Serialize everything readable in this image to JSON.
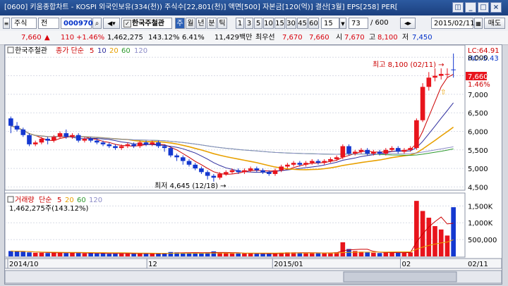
{
  "window": {
    "title": "[0600] 키움종합차트 - KOSPI 외국인보유(334(천)) 주식수[22,801(천)] 액면[500] 자본금[120(억)] 결산[3월] EPS[258] PER[",
    "buttons": [
      "◫",
      "_",
      "□",
      "×"
    ]
  },
  "toolbar": {
    "type_label": "주식",
    "all_label": "전",
    "code_value": "000970",
    "company_name": "한국주철관",
    "periods": [
      "주",
      "월",
      "년",
      "분",
      "틱"
    ],
    "minutes": [
      "1",
      "3",
      "5",
      "10",
      "15",
      "30",
      "45",
      "60"
    ],
    "minute_dropdown": "15",
    "count_value": "73",
    "count_total": "/ 600",
    "date_value": "2015/02/11",
    "trade_button": "매도"
  },
  "quote": {
    "price": "7,660",
    "change": "110",
    "change_pct": "+1.46%",
    "volume": "1,462,275",
    "vol_ratio": "143.12%",
    "turnover": "6.41%",
    "amount": "11,429백만",
    "pref_label": "최우선",
    "pref_ask": "7,670",
    "pref_bid": "7,660",
    "open_label": "시",
    "open": "7,670",
    "high_label": "고",
    "high": "8,100",
    "low_label": "저",
    "low": "7,450"
  },
  "price_panel": {
    "company": "한국주철관",
    "legend_label": "종가 단순",
    "ma_periods": [
      "5",
      "10",
      "20",
      "60",
      "120"
    ],
    "ma_colors": [
      "#cc0000",
      "#2f2f9f",
      "#e8a000",
      "#2e9a2e",
      "#8c8cc8"
    ],
    "lc_label": "LC:64.91",
    "hc_label": "HC:-5.43",
    "high_annotation": "최고 8,100 (02/11) →",
    "low_annotation": "최저 4,645 (12/18) →",
    "price_tag": "7,660",
    "pct_tag": "1.46%",
    "y_ticks": [
      "8,000",
      "7,500",
      "7,000",
      "6,500",
      "6,000",
      "5,500",
      "5,000",
      "4,500"
    ]
  },
  "volume_panel": {
    "title": "거래량",
    "legend_label": "단순",
    "ma_periods": [
      "5",
      "20",
      "60",
      "120"
    ],
    "readout": "1,462,275주(143.12%)",
    "y_ticks": [
      "1,500K",
      "1,000K",
      "500,000"
    ]
  },
  "x_axis": {
    "labels": [
      "2014/10",
      "12",
      "2015/01",
      "02",
      "02/11"
    ]
  },
  "colors": {
    "up": "#e8141c",
    "down": "#1438d0",
    "title_bar": "#1b3f7e"
  },
  "chart_data": {
    "type": "candlestick",
    "date_range": [
      "2014/10",
      "2015/02/11"
    ],
    "price_range": [
      4500,
      8100
    ],
    "high": {
      "value": 8100,
      "date": "02/11"
    },
    "low": {
      "value": 4645,
      "date": "12/18"
    },
    "candles": [
      [
        6350,
        6150,
        6400,
        5950
      ],
      [
        6150,
        6050,
        6250,
        6000
      ],
      [
        6050,
        5900,
        6100,
        5850
      ],
      [
        5900,
        5650,
        5950,
        5600
      ],
      [
        5650,
        5700,
        5750,
        5600
      ],
      [
        5700,
        5800,
        5850,
        5650
      ],
      [
        5800,
        5750,
        5850,
        5650
      ],
      [
        5750,
        5850,
        5900,
        5700
      ],
      [
        5850,
        5950,
        6000,
        5800
      ],
      [
        5950,
        5850,
        6050,
        5800
      ],
      [
        5850,
        5900,
        5950,
        5800
      ],
      [
        5900,
        5750,
        5950,
        5700
      ],
      [
        5750,
        5800,
        5850,
        5700
      ],
      [
        5800,
        5750,
        5850,
        5700
      ],
      [
        5750,
        5700,
        5800,
        5650
      ],
      [
        5700,
        5650,
        5750,
        5600
      ],
      [
        5650,
        5600,
        5700,
        5550
      ],
      [
        5600,
        5550,
        5650,
        5500
      ],
      [
        5550,
        5600,
        5650,
        5500
      ],
      [
        5600,
        5650,
        5700,
        5550
      ],
      [
        5650,
        5600,
        5700,
        5550
      ],
      [
        5600,
        5700,
        5750,
        5550
      ],
      [
        5700,
        5650,
        5750,
        5600
      ],
      [
        5650,
        5700,
        5750,
        5600
      ],
      [
        5700,
        5600,
        5750,
        5550
      ],
      [
        5600,
        5550,
        5650,
        5450
      ],
      [
        5550,
        5350,
        5600,
        5300
      ],
      [
        5350,
        5300,
        5400,
        5200
      ],
      [
        5300,
        5200,
        5350,
        5100
      ],
      [
        5200,
        5100,
        5250,
        5050
      ],
      [
        5100,
        5000,
        5150,
        4950
      ],
      [
        5000,
        4900,
        5050,
        4850
      ],
      [
        4900,
        4800,
        4950,
        4700
      ],
      [
        4800,
        4750,
        4850,
        4645
      ],
      [
        4750,
        4850,
        4900,
        4700
      ],
      [
        4850,
        4900,
        4950,
        4800
      ],
      [
        4900,
        4950,
        5000,
        4850
      ],
      [
        4950,
        4900,
        5000,
        4850
      ],
      [
        4900,
        4950,
        5000,
        4850
      ],
      [
        4950,
        5000,
        5050,
        4900
      ],
      [
        5000,
        4950,
        5050,
        4900
      ],
      [
        4950,
        4900,
        5000,
        4850
      ],
      [
        4900,
        4850,
        4950,
        4800
      ],
      [
        4850,
        4950,
        5000,
        4800
      ],
      [
        4950,
        5050,
        5100,
        4900
      ],
      [
        5050,
        5100,
        5150,
        5000
      ],
      [
        5100,
        5150,
        5200,
        5050
      ],
      [
        5150,
        5100,
        5200,
        5050
      ],
      [
        5100,
        5150,
        5200,
        5050
      ],
      [
        5150,
        5200,
        5250,
        5100
      ],
      [
        5200,
        5150,
        5250,
        5100
      ],
      [
        5150,
        5200,
        5250,
        5100
      ],
      [
        5200,
        5250,
        5300,
        5150
      ],
      [
        5250,
        5300,
        5350,
        5200
      ],
      [
        5300,
        5600,
        5650,
        5250
      ],
      [
        5600,
        5400,
        5650,
        5350
      ],
      [
        5400,
        5450,
        5500,
        5350
      ],
      [
        5450,
        5500,
        5550,
        5400
      ],
      [
        5500,
        5400,
        5550,
        5350
      ],
      [
        5400,
        5450,
        5500,
        5350
      ],
      [
        5450,
        5400,
        5500,
        5350
      ],
      [
        5400,
        5500,
        5550,
        5350
      ],
      [
        5500,
        5550,
        5600,
        5450
      ],
      [
        5550,
        5450,
        5600,
        5400
      ],
      [
        5450,
        5500,
        5550,
        5400
      ],
      [
        5500,
        5550,
        5600,
        5450
      ],
      [
        5550,
        6300,
        6350,
        5500
      ],
      [
        6300,
        7200,
        7300,
        6250
      ],
      [
        7200,
        7450,
        7600,
        7100
      ],
      [
        7450,
        7500,
        7700,
        7350
      ],
      [
        7500,
        7550,
        7700,
        7400
      ],
      [
        7550,
        7550,
        7700,
        7450
      ],
      [
        7670,
        7660,
        8100,
        7450
      ]
    ],
    "volumes": [
      160,
      150,
      140,
      120,
      110,
      110,
      100,
      110,
      120,
      100,
      110,
      100,
      90,
      100,
      90,
      90,
      80,
      90,
      90,
      90,
      80,
      90,
      80,
      90,
      80,
      90,
      130,
      120,
      110,
      100,
      100,
      110,
      120,
      150,
      110,
      100,
      90,
      90,
      90,
      90,
      80,
      80,
      80,
      90,
      110,
      120,
      120,
      100,
      100,
      110,
      100,
      100,
      110,
      120,
      420,
      220,
      160,
      140,
      120,
      110,
      100,
      120,
      130,
      110,
      110,
      120,
      1650,
      1350,
      1150,
      900,
      800,
      620,
      1462
    ]
  }
}
